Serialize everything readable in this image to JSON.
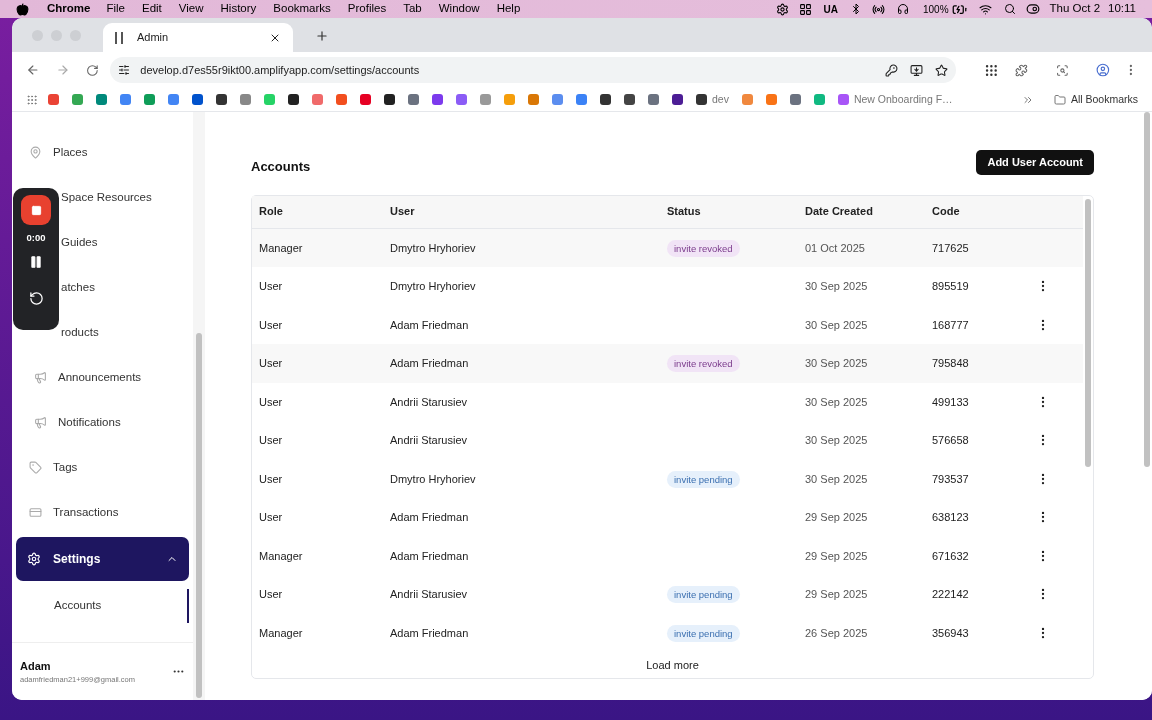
{
  "menu_bar": {
    "app": "Chrome",
    "menus": [
      "File",
      "Edit",
      "View",
      "History",
      "Bookmarks",
      "Profiles",
      "Tab",
      "Window",
      "Help"
    ],
    "input_source": "UA",
    "battery": "100%",
    "date": "Thu Oct 2",
    "time": "10:11"
  },
  "browser": {
    "tab": {
      "title": "Admin",
      "selected": true
    },
    "url": "develop.d7es55r9ikt00.amplifyapp.com/settings/accounts",
    "bookmarks": [
      {
        "color": "#ea4335"
      },
      {
        "color": "#34a853"
      },
      {
        "color": "#00897b"
      },
      {
        "color": "#4285f4"
      },
      {
        "color": "#0f9d58"
      },
      {
        "color": "#4285f4"
      },
      {
        "color": "#0052cc"
      },
      {
        "color": "#333333"
      },
      {
        "color": "#888888"
      },
      {
        "color": "#25d366"
      },
      {
        "color": "#222222"
      },
      {
        "color": "#f06a6a"
      },
      {
        "color": "#f24e1e"
      },
      {
        "color": "#e60023"
      },
      {
        "color": "#222222"
      },
      {
        "color": "#6b7280"
      },
      {
        "color": "#7c3aed"
      },
      {
        "color": "#8b5cf6"
      },
      {
        "color": "#999999"
      },
      {
        "color": "#f59e0b"
      },
      {
        "color": "#d97706"
      },
      {
        "color": "#5b8def"
      },
      {
        "color": "#3b82f6"
      },
      {
        "color": "#333333"
      },
      {
        "color": "#444444"
      },
      {
        "color": "#6b7280"
      },
      {
        "color": "#4c1d95"
      },
      {
        "color": "#333333",
        "label": "dev"
      },
      {
        "color": "#f0883e"
      },
      {
        "color": "#f97316"
      },
      {
        "color": "#6b7280"
      },
      {
        "color": "#10b981"
      },
      {
        "color": "#a855f7",
        "label": "New Onboarding F…"
      }
    ],
    "all_bookmarks": "All Bookmarks"
  },
  "recorder": {
    "time": "0:00"
  },
  "sidebar": {
    "items": [
      {
        "label": "Places",
        "selected": false
      },
      {
        "label": "Space Resources",
        "selected": false
      },
      {
        "label": "Guides",
        "selected": false
      },
      {
        "label": "atches",
        "selected": false
      },
      {
        "label": "roducts",
        "selected": false
      },
      {
        "label": "Announcements",
        "selected": false
      },
      {
        "label": "Notifications",
        "selected": false
      },
      {
        "label": "Tags",
        "selected": false
      },
      {
        "label": "Transactions",
        "selected": false
      },
      {
        "label": "Settings",
        "selected": true,
        "expanded": true,
        "children": [
          {
            "label": "Accounts",
            "selected": true
          }
        ]
      }
    ],
    "user": {
      "name": "Adam",
      "email": "adamfriedman21+999@gmail.com"
    }
  },
  "page": {
    "title": "Accounts",
    "add_button": "Add User Account",
    "table": {
      "columns": [
        "Role",
        "User",
        "Status",
        "Date Created",
        "Code"
      ],
      "rows": [
        {
          "role": "Manager",
          "user": "Dmytro Hryhoriev",
          "status": "invite revoked",
          "kind": "revoked",
          "date": "01 Oct 2025",
          "code": "717625"
        },
        {
          "role": "User",
          "user": "Dmytro Hryhoriev",
          "kind": "active",
          "date": "30 Sep 2025",
          "code": "895519"
        },
        {
          "role": "User",
          "user": "Adam Friedman",
          "kind": "active",
          "date": "30 Sep 2025",
          "code": "168777"
        },
        {
          "role": "User",
          "user": "Adam Friedman",
          "status": "invite revoked",
          "kind": "revoked",
          "date": "30 Sep 2025",
          "code": "795848"
        },
        {
          "role": "User",
          "user": "Andrii Starusiev",
          "kind": "active",
          "date": "30 Sep 2025",
          "code": "499133"
        },
        {
          "role": "User",
          "user": "Andrii Starusiev",
          "kind": "active",
          "date": "30 Sep 2025",
          "code": "576658"
        },
        {
          "role": "User",
          "user": "Dmytro Hryhoriev",
          "status": "invite pending",
          "kind": "pending",
          "date": "30 Sep 2025",
          "code": "793537"
        },
        {
          "role": "User",
          "user": "Adam Friedman",
          "kind": "active",
          "date": "29 Sep 2025",
          "code": "638123"
        },
        {
          "role": "Manager",
          "user": "Adam Friedman",
          "kind": "active",
          "date": "29 Sep 2025",
          "code": "671632"
        },
        {
          "role": "User",
          "user": "Andrii Starusiev",
          "status": "invite pending",
          "kind": "pending",
          "date": "29 Sep 2025",
          "code": "222142"
        },
        {
          "role": "Manager",
          "user": "Adam Friedman",
          "status": "invite pending",
          "kind": "pending",
          "date": "26 Sep 2025",
          "code": "356943"
        }
      ],
      "load_more": "Load more"
    }
  }
}
